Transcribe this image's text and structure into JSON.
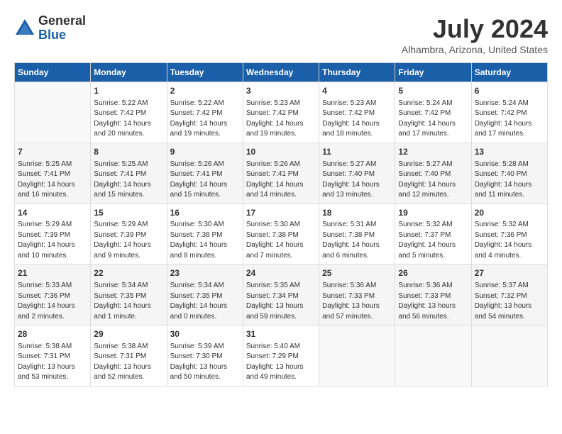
{
  "logo": {
    "general": "General",
    "blue": "Blue"
  },
  "title": {
    "month_year": "July 2024",
    "location": "Alhambra, Arizona, United States"
  },
  "days_of_week": [
    "Sunday",
    "Monday",
    "Tuesday",
    "Wednesday",
    "Thursday",
    "Friday",
    "Saturday"
  ],
  "weeks": [
    [
      {
        "day": "",
        "info": ""
      },
      {
        "day": "1",
        "info": "Sunrise: 5:22 AM\nSunset: 7:42 PM\nDaylight: 14 hours\nand 20 minutes."
      },
      {
        "day": "2",
        "info": "Sunrise: 5:22 AM\nSunset: 7:42 PM\nDaylight: 14 hours\nand 19 minutes."
      },
      {
        "day": "3",
        "info": "Sunrise: 5:23 AM\nSunset: 7:42 PM\nDaylight: 14 hours\nand 19 minutes."
      },
      {
        "day": "4",
        "info": "Sunrise: 5:23 AM\nSunset: 7:42 PM\nDaylight: 14 hours\nand 18 minutes."
      },
      {
        "day": "5",
        "info": "Sunrise: 5:24 AM\nSunset: 7:42 PM\nDaylight: 14 hours\nand 17 minutes."
      },
      {
        "day": "6",
        "info": "Sunrise: 5:24 AM\nSunset: 7:42 PM\nDaylight: 14 hours\nand 17 minutes."
      }
    ],
    [
      {
        "day": "7",
        "info": "Sunrise: 5:25 AM\nSunset: 7:41 PM\nDaylight: 14 hours\nand 16 minutes."
      },
      {
        "day": "8",
        "info": "Sunrise: 5:25 AM\nSunset: 7:41 PM\nDaylight: 14 hours\nand 15 minutes."
      },
      {
        "day": "9",
        "info": "Sunrise: 5:26 AM\nSunset: 7:41 PM\nDaylight: 14 hours\nand 15 minutes."
      },
      {
        "day": "10",
        "info": "Sunrise: 5:26 AM\nSunset: 7:41 PM\nDaylight: 14 hours\nand 14 minutes."
      },
      {
        "day": "11",
        "info": "Sunrise: 5:27 AM\nSunset: 7:40 PM\nDaylight: 14 hours\nand 13 minutes."
      },
      {
        "day": "12",
        "info": "Sunrise: 5:27 AM\nSunset: 7:40 PM\nDaylight: 14 hours\nand 12 minutes."
      },
      {
        "day": "13",
        "info": "Sunrise: 5:28 AM\nSunset: 7:40 PM\nDaylight: 14 hours\nand 11 minutes."
      }
    ],
    [
      {
        "day": "14",
        "info": "Sunrise: 5:29 AM\nSunset: 7:39 PM\nDaylight: 14 hours\nand 10 minutes."
      },
      {
        "day": "15",
        "info": "Sunrise: 5:29 AM\nSunset: 7:39 PM\nDaylight: 14 hours\nand 9 minutes."
      },
      {
        "day": "16",
        "info": "Sunrise: 5:30 AM\nSunset: 7:38 PM\nDaylight: 14 hours\nand 8 minutes."
      },
      {
        "day": "17",
        "info": "Sunrise: 5:30 AM\nSunset: 7:38 PM\nDaylight: 14 hours\nand 7 minutes."
      },
      {
        "day": "18",
        "info": "Sunrise: 5:31 AM\nSunset: 7:38 PM\nDaylight: 14 hours\nand 6 minutes."
      },
      {
        "day": "19",
        "info": "Sunrise: 5:32 AM\nSunset: 7:37 PM\nDaylight: 14 hours\nand 5 minutes."
      },
      {
        "day": "20",
        "info": "Sunrise: 5:32 AM\nSunset: 7:36 PM\nDaylight: 14 hours\nand 4 minutes."
      }
    ],
    [
      {
        "day": "21",
        "info": "Sunrise: 5:33 AM\nSunset: 7:36 PM\nDaylight: 14 hours\nand 2 minutes."
      },
      {
        "day": "22",
        "info": "Sunrise: 5:34 AM\nSunset: 7:35 PM\nDaylight: 14 hours\nand 1 minute."
      },
      {
        "day": "23",
        "info": "Sunrise: 5:34 AM\nSunset: 7:35 PM\nDaylight: 14 hours\nand 0 minutes."
      },
      {
        "day": "24",
        "info": "Sunrise: 5:35 AM\nSunset: 7:34 PM\nDaylight: 13 hours\nand 59 minutes."
      },
      {
        "day": "25",
        "info": "Sunrise: 5:36 AM\nSunset: 7:33 PM\nDaylight: 13 hours\nand 57 minutes."
      },
      {
        "day": "26",
        "info": "Sunrise: 5:36 AM\nSunset: 7:33 PM\nDaylight: 13 hours\nand 56 minutes."
      },
      {
        "day": "27",
        "info": "Sunrise: 5:37 AM\nSunset: 7:32 PM\nDaylight: 13 hours\nand 54 minutes."
      }
    ],
    [
      {
        "day": "28",
        "info": "Sunrise: 5:38 AM\nSunset: 7:31 PM\nDaylight: 13 hours\nand 53 minutes."
      },
      {
        "day": "29",
        "info": "Sunrise: 5:38 AM\nSunset: 7:31 PM\nDaylight: 13 hours\nand 52 minutes."
      },
      {
        "day": "30",
        "info": "Sunrise: 5:39 AM\nSunset: 7:30 PM\nDaylight: 13 hours\nand 50 minutes."
      },
      {
        "day": "31",
        "info": "Sunrise: 5:40 AM\nSunset: 7:29 PM\nDaylight: 13 hours\nand 49 minutes."
      },
      {
        "day": "",
        "info": ""
      },
      {
        "day": "",
        "info": ""
      },
      {
        "day": "",
        "info": ""
      }
    ]
  ]
}
